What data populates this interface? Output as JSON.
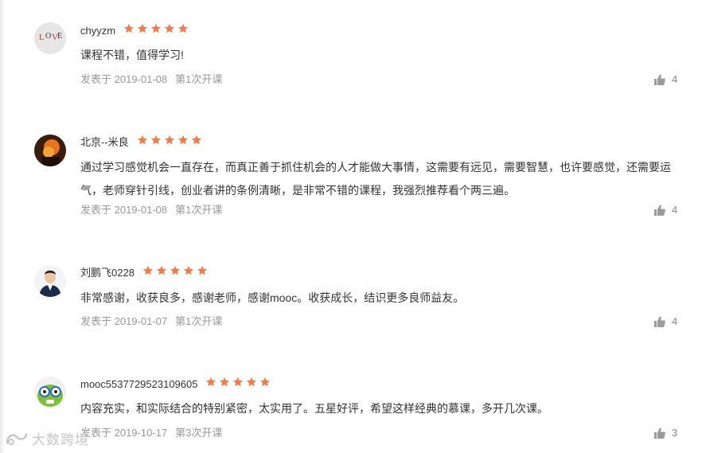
{
  "reviews": [
    {
      "username": "chyyzm",
      "rating": 5,
      "content": "课程不错，值得学习!",
      "date": "发表于 2019-01-08",
      "session": "第1次开课",
      "likes": "4"
    },
    {
      "username": "北京--米良",
      "rating": 5,
      "content": "通过学习感觉机会一直存在，而真正善于抓住机会的人才能做大事情，这需要有远见，需要智慧，也许要感觉，还需要运气，老师穿针引线，创业者讲的条例清晰，是非常不错的课程，我强烈推荐看个两三遍。",
      "date": "发表于 2019-01-08",
      "session": "第1次开课",
      "likes": "4"
    },
    {
      "username": "刘鹏飞0228",
      "rating": 5,
      "content": "非常感谢，收获良多，感谢老师，感谢mooc。收获成长，结识更多良师益友。",
      "date": "发表于 2019-01-07",
      "session": "第1次开课",
      "likes": "4"
    },
    {
      "username": "mooc5537729523109605",
      "rating": 5,
      "content": "内容充实，和实际结合的特别紧密，太实用了。五星好评，希望这样经典的慕课，多开几次课。",
      "date": "发表于 2019-10-17",
      "session": "第3次开课",
      "likes": "3"
    }
  ],
  "watermark": "大数跨境",
  "colors": {
    "star": "#f07c4b",
    "text": "#333333",
    "meta": "#999999",
    "like_icon": "#9a9a9a"
  },
  "icons": {
    "star": "star-icon",
    "like": "thumbs-up-icon"
  }
}
